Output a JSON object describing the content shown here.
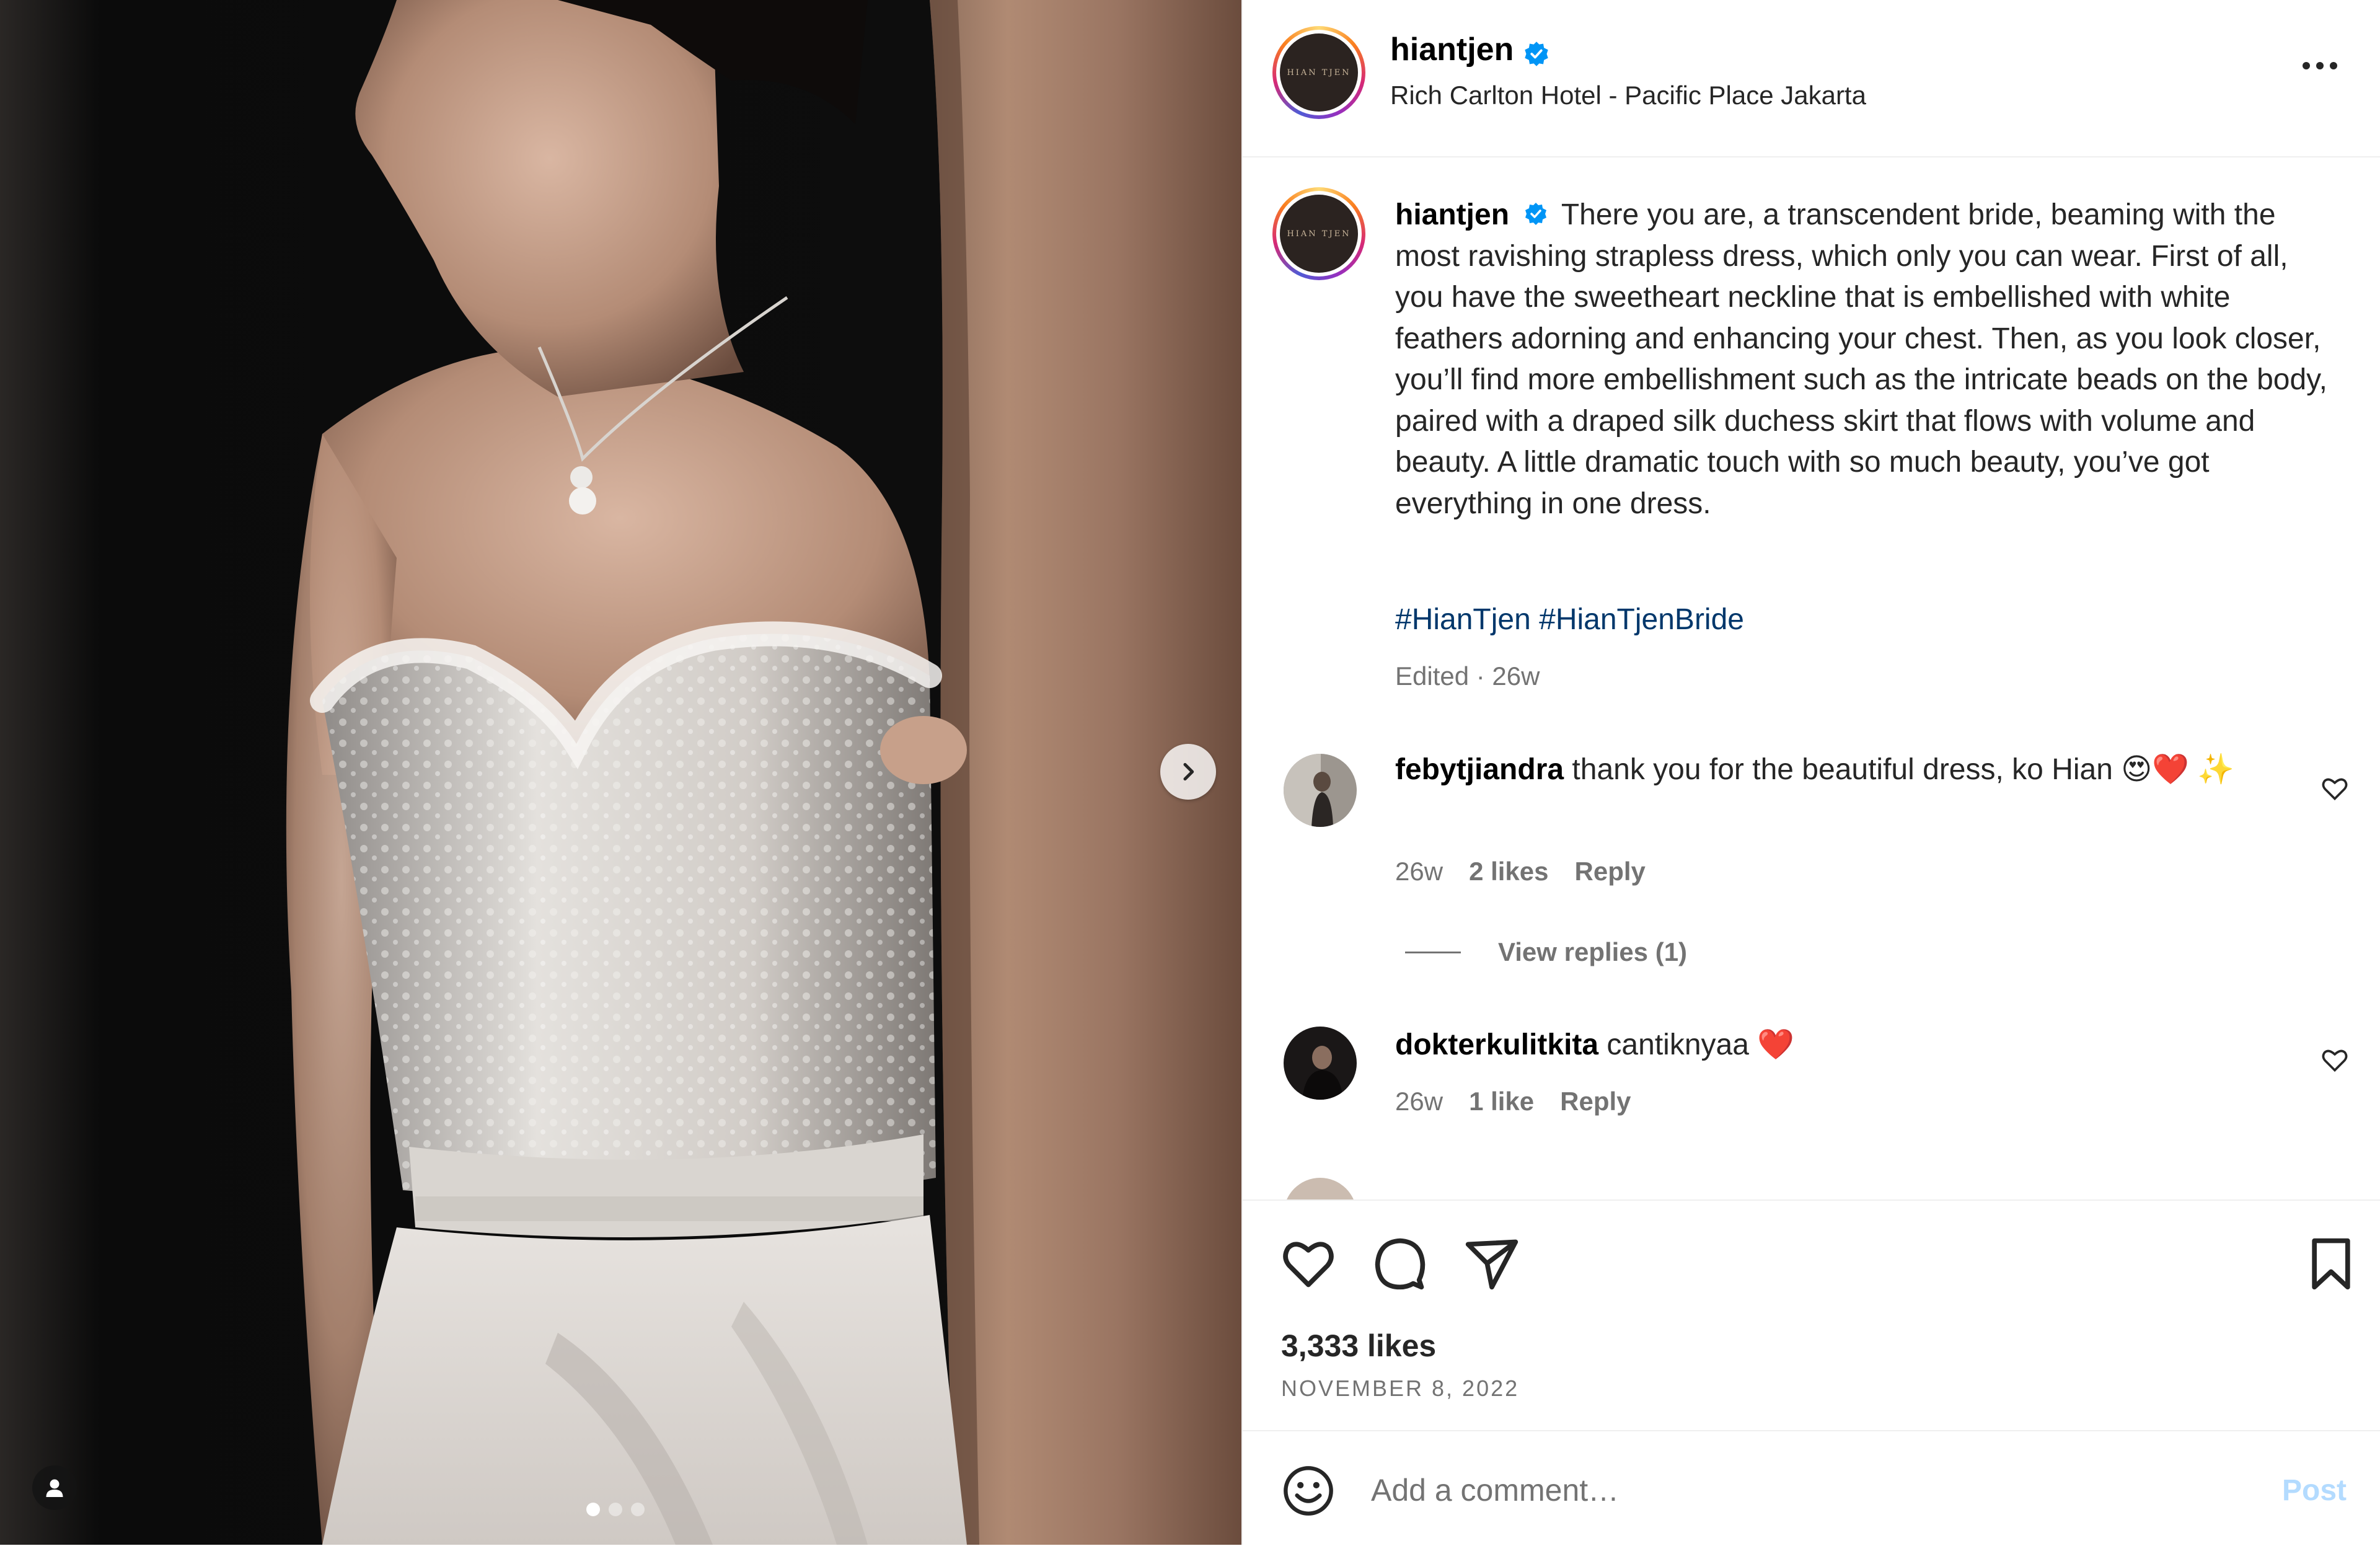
{
  "post": {
    "username": "hiantjen",
    "verified": true,
    "location": "Rich Carlton Hotel - Pacific Place Jakarta",
    "avatar_text": "HIAN TJEN",
    "caption": "There you are, a transcendent bride, beaming with the most ravishing strapless dress, which only you can wear. First of all, you have the sweetheart neckline that is embellished with white feathers adorning and enhancing your chest. Then, as you look closer, you’ll find more embellishment such as the intricate beads on the body, paired with a draped silk duchess skirt that flows with volume and beauty. A little dramatic touch with so much beauty, you’ve got everything in one dress.",
    "hashtags": [
      "#HianTjen",
      "#HianTjenBride"
    ],
    "edited_time": "Edited · 26w",
    "likes": "3,333 likes",
    "date": "NOVEMBER 8, 2022"
  },
  "media": {
    "carousel_count": 3,
    "active_index": 0,
    "next_icon": "chevron-right-icon",
    "tag_icon": "person-icon"
  },
  "comments": [
    {
      "username": "febytjiandra",
      "text": "thank you for the beautiful dress, ko Hian 😍❤️ ✨",
      "time": "26w",
      "likes": "2 likes",
      "reply": "Reply",
      "view_replies": "View replies (1)"
    },
    {
      "username": "dokterkulitkita",
      "text": "cantiknyaa ❤️",
      "time": "26w",
      "likes": "1 like",
      "reply": "Reply"
    }
  ],
  "add_comment": {
    "placeholder": "Add a comment…",
    "post_label": "Post"
  },
  "colors": {
    "hashtag": "#00376b",
    "verified": "#0095f6",
    "post_disabled": "#b3dbff",
    "secondary_text": "#737373"
  }
}
